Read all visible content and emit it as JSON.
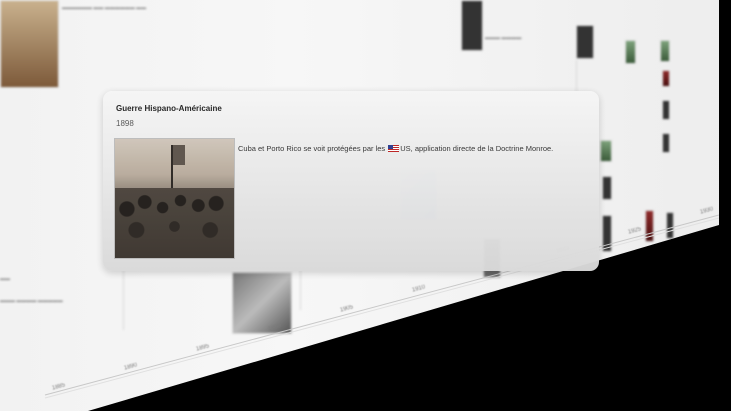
{
  "popup": {
    "title": "Guerre Hispano-Américaine",
    "date": "1898",
    "description_before": "Cuba et Porto Rico se voit protégées par les ",
    "description_flag_icon": "us-flag-icon",
    "description_after": "US, application directe de la Doctrine Monroe."
  },
  "timeline": {
    "tick_labels": [
      "1885",
      "1890",
      "1895",
      "1900",
      "1905",
      "1910",
      "1915",
      "1920",
      "1925",
      "1930"
    ]
  },
  "colors": {
    "background": "#000000",
    "card": "#e6e6e6",
    "flag_red": "#bb2222",
    "flag_blue": "#2a3b8f"
  }
}
